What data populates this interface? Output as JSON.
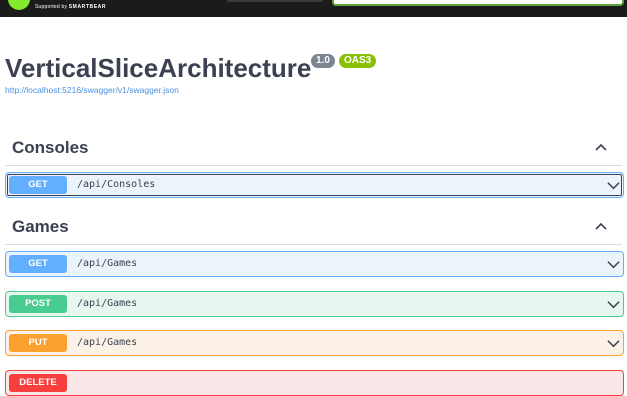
{
  "topbar": {
    "supported_by": "Supported by",
    "smartbear": "SMARTBEAR",
    "logo_mark": "{…}",
    "search": {
      "value": ""
    }
  },
  "info": {
    "title": "VerticalSliceArchitecture",
    "version": "1.0",
    "oas": "OAS3",
    "spec_url": "http://localhost:5216/swagger/v1/swagger.json"
  },
  "sections": [
    {
      "name": "Consoles",
      "operations": [
        {
          "method": "GET",
          "path": "/api/Consoles"
        }
      ]
    },
    {
      "name": "Games",
      "operations": [
        {
          "method": "GET",
          "path": "/api/Games"
        },
        {
          "method": "POST",
          "path": "/api/Games"
        },
        {
          "method": "PUT",
          "path": "/api/Games"
        },
        {
          "method": "DELETE",
          "path": ""
        }
      ]
    }
  ],
  "colors": {
    "topbar": "#1b1b1b",
    "get": "#61affe",
    "post": "#49cc90",
    "put": "#fca130",
    "delete": "#f93e3e",
    "text": "#3b4151",
    "link": "#4990e2"
  },
  "icons": {
    "collapse": "chevron-up-icon",
    "expand": "chevron-down-icon",
    "logo": "swagger-logo-icon"
  }
}
